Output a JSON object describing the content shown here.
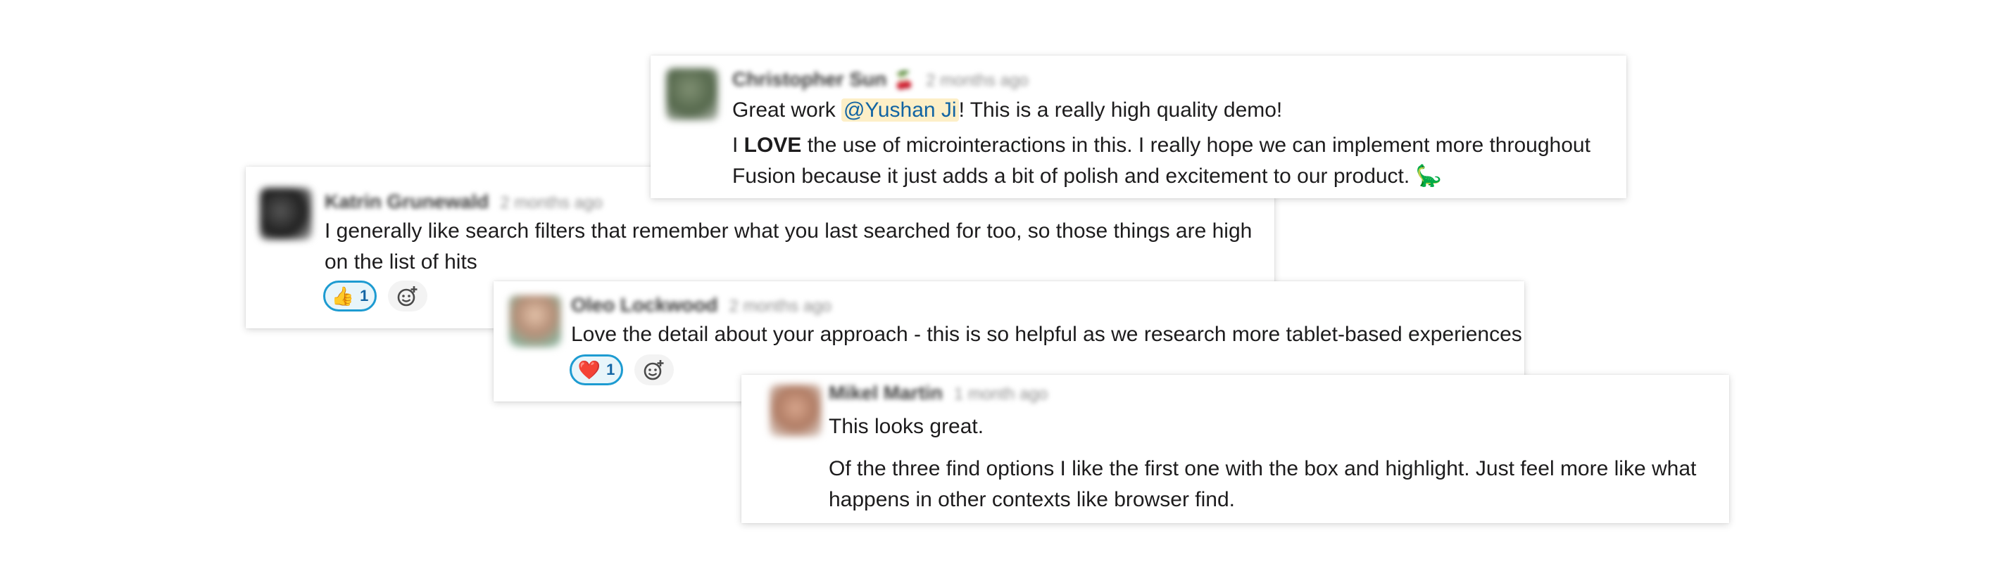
{
  "comments": [
    {
      "author": "Christopher Sun",
      "flag": "🍒",
      "time": "2 months ago",
      "line1_pre": "Great work ",
      "mention": "@Yushan Ji",
      "line1_post": "! This is a really high quality demo!",
      "line2_pre": "I ",
      "line2_bold": "LOVE",
      "line2_post": " the use of microinteractions in this. I really hope we can implement more throughout",
      "line3": "Fusion because it just adds a bit of polish and excitement to our product.",
      "emoji": "🦕"
    },
    {
      "author": "Katrin Grunewald",
      "time": "2 months ago",
      "line1": "I generally like search filters that remember what you last searched for too, so those things are high",
      "line2": "on the list of hits",
      "reaction_emoji": "👍",
      "reaction_count": "1"
    },
    {
      "author": "Oleo Lockwood",
      "time": "2 months ago",
      "line1": "Love the detail about your approach - this is so helpful as we research more tablet-based experiences",
      "reaction_emoji": "❤️",
      "reaction_count": "1"
    },
    {
      "author": "Mikel Martin",
      "time": "1 month ago",
      "line1": "This looks great.",
      "line2": "Of the three find options I like the first one with the box and highlight. Just feel more like what",
      "line3": "happens in other contexts like browser find."
    }
  ],
  "colors": {
    "mention_bg": "#fdefc7",
    "mention_text": "#1264a3",
    "reaction_border": "#1d9bd1"
  }
}
